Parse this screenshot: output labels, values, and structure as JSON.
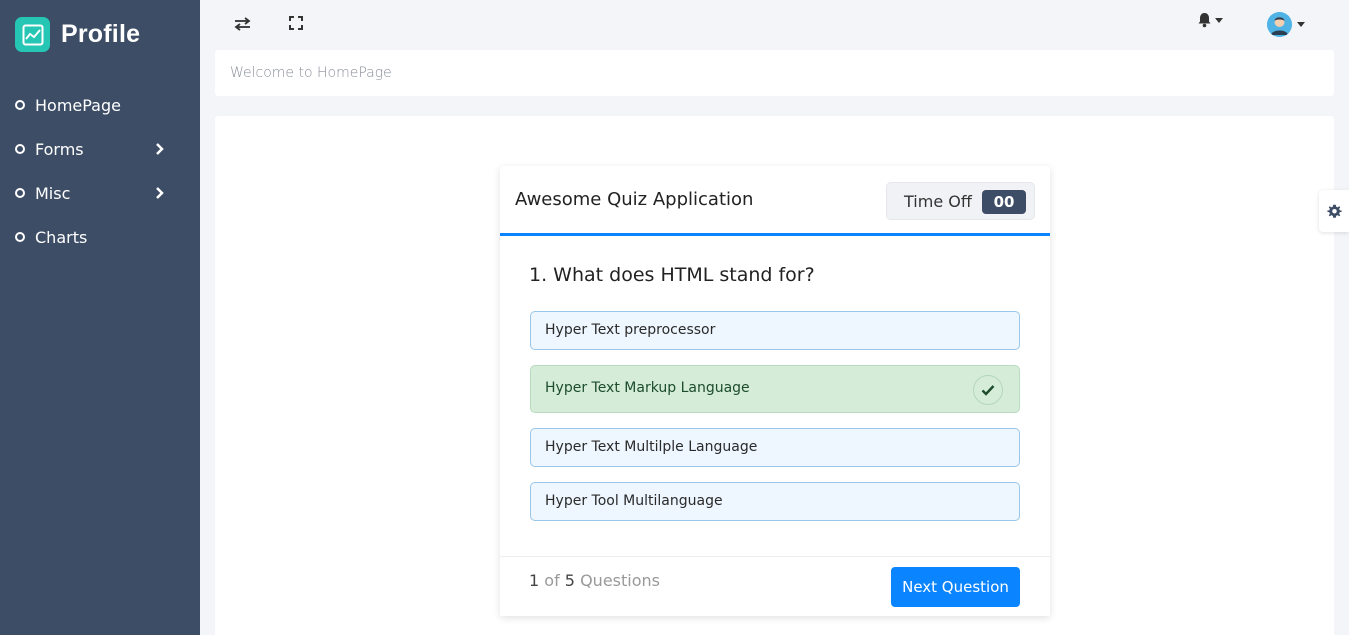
{
  "brand": {
    "title": "Profile",
    "icon": "chart-line-icon",
    "color": "#26c6b4"
  },
  "sidebar": {
    "background": "#3d4d66",
    "items": [
      {
        "label": "HomePage",
        "has_submenu": false
      },
      {
        "label": "Forms",
        "has_submenu": true
      },
      {
        "label": "Misc",
        "has_submenu": true
      },
      {
        "label": "Charts",
        "has_submenu": false
      }
    ]
  },
  "topbar": {
    "icons": [
      "swap-icon",
      "fullscreen-icon",
      "bell-icon",
      "user-avatar"
    ]
  },
  "welcome": {
    "text": "Welcome to HomePage"
  },
  "quiz": {
    "title": "Awesome Quiz Application",
    "timer_label": "Time Off",
    "timer_value": "00",
    "question": "1. What does HTML stand for?",
    "options": [
      {
        "label": "Hyper Text preprocessor",
        "state": "default"
      },
      {
        "label": "Hyper Text Markup Language",
        "state": "correct"
      },
      {
        "label": "Hyper Text Multilple Language",
        "state": "default"
      },
      {
        "label": "Hyper Tool Multilanguage",
        "state": "default"
      }
    ],
    "footer": {
      "current": "1",
      "of": "of",
      "total": "5",
      "suffix": "Questions"
    },
    "next_label": "Next Question"
  },
  "colors": {
    "accent": "#0a84ff",
    "correct_bg": "#d4ecd8",
    "option_bg": "#eef6ff"
  }
}
